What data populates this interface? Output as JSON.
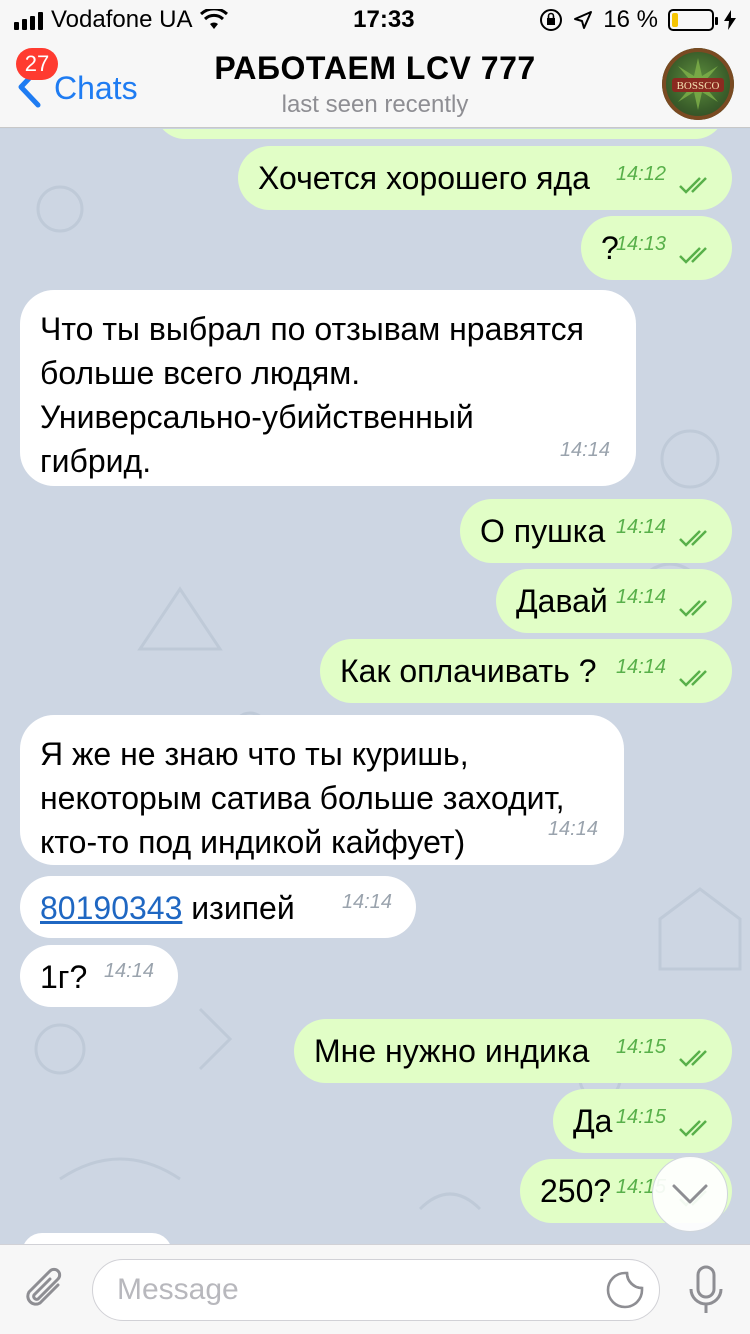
{
  "status_bar": {
    "carrier": "Vodafone UA",
    "time": "17:33",
    "battery_percent": "16 %",
    "battery_level": 0.16,
    "battery_color": "#f5c400"
  },
  "nav": {
    "back_label": "Chats",
    "unread_badge": "27",
    "title": "РАБОТАЕМ LCV 777",
    "subtitle": "last seen recently",
    "avatar_text": "BOSSCO"
  },
  "messages": [
    {
      "dir": "out",
      "text": "Хочется хорошего яда",
      "time": "14:12"
    },
    {
      "dir": "out",
      "text": "?",
      "time": "14:13"
    },
    {
      "dir": "in",
      "lines": [
        "Что ты выбрал по отзывам нравятся",
        "больше всего людям.",
        "Универсально-убийственный",
        "гибрид."
      ],
      "time": "14:14"
    },
    {
      "dir": "out",
      "text": "О пушка",
      "time": "14:14"
    },
    {
      "dir": "out",
      "text": "Давай",
      "time": "14:14"
    },
    {
      "dir": "out",
      "text": "Как оплачивать ?",
      "time": "14:14"
    },
    {
      "dir": "in",
      "lines": [
        "Я же не знаю что ты куришь,",
        "некоторым сатива больше заходит,",
        "кто-то под индикой кайфует)"
      ],
      "time": "14:14"
    },
    {
      "dir": "in",
      "link": "80190343",
      "text": " изипей",
      "time": "14:14"
    },
    {
      "dir": "in",
      "text": "1г?",
      "time": "14:14"
    },
    {
      "dir": "out",
      "text": "Мне нужно индика",
      "time": "14:15"
    },
    {
      "dir": "out",
      "text": "Да",
      "time": "14:15"
    },
    {
      "dir": "out",
      "text": "250?",
      "time": "14:15"
    }
  ],
  "input": {
    "placeholder": "Message"
  },
  "colors": {
    "accent": "#1f7cf2",
    "outgoing_bubble": "#e1fec6",
    "incoming_bubble": "#ffffff",
    "badge": "#ff3b30",
    "time_out": "#58b04a"
  },
  "icons": [
    "wifi-icon",
    "lock-rotation-icon",
    "location-arrow-icon",
    "charging-icon",
    "back-chevron-icon",
    "double-check-icon",
    "chevron-down-icon",
    "paperclip-icon",
    "sticker-icon",
    "microphone-icon"
  ]
}
